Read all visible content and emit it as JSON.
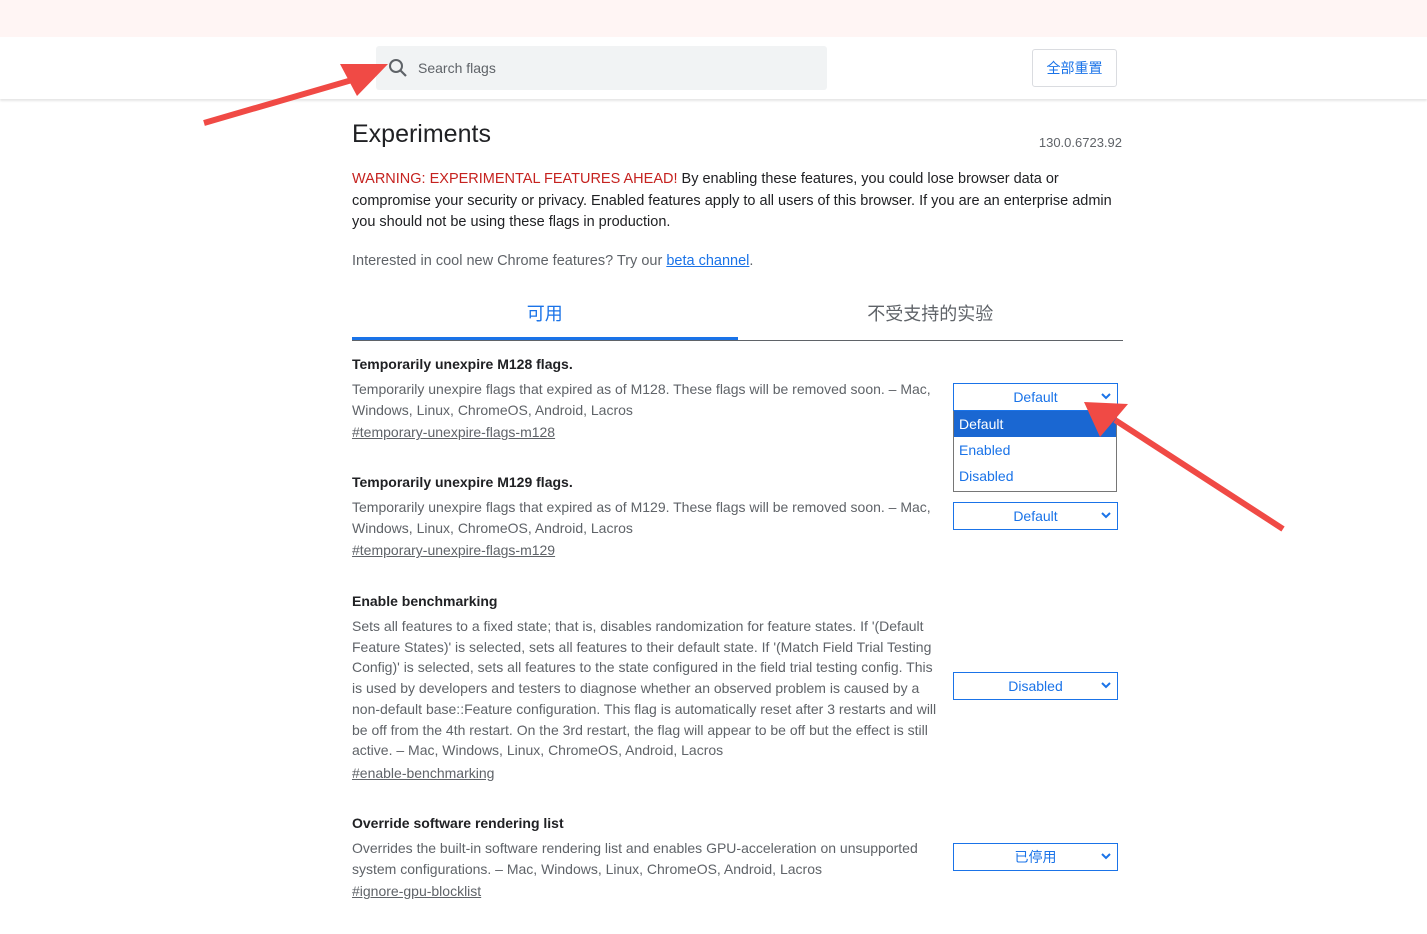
{
  "header": {
    "search_placeholder": "Search flags",
    "reset_all": "全部重置"
  },
  "page": {
    "title": "Experiments",
    "version": "130.0.6723.92",
    "warning_prefix": "WARNING: EXPERIMENTAL FEATURES AHEAD!",
    "warning_text": " By enabling these features, you could lose browser data or compromise your security or privacy. Enabled features apply to all users of this browser. If you are an enterprise admin you should not be using these flags in production.",
    "interest_text": "Interested in cool new Chrome features? Try our ",
    "beta_link": "beta channel",
    "interest_end": "."
  },
  "tabs": [
    {
      "label": "可用",
      "active": true
    },
    {
      "label": "不受支持的实验",
      "active": false
    }
  ],
  "flags": [
    {
      "name": "Temporarily unexpire M128 flags.",
      "description": "Temporarily unexpire flags that expired as of M128. These flags will be removed soon. – Mac, Windows, Linux, ChromeOS, Android, Lacros",
      "id": "#temporary-unexpire-flags-m128",
      "value": "Default"
    },
    {
      "name": "Temporarily unexpire M129 flags.",
      "description": "Temporarily unexpire flags that expired as of M129. These flags will be removed soon. – Mac, Windows, Linux, ChromeOS, Android, Lacros",
      "id": "#temporary-unexpire-flags-m129",
      "value": "Default"
    },
    {
      "name": "Enable benchmarking",
      "description": "Sets all features to a fixed state; that is, disables randomization for feature states. If '(Default Feature States)' is selected, sets all features to their default state. If '(Match Field Trial Testing Config)' is selected, sets all features to the state configured in the field trial testing config. This is used by developers and testers to diagnose whether an observed problem is caused by a non-default base::Feature configuration. This flag is automatically reset after 3 restarts and will be off from the 4th restart. On the 3rd restart, the flag will appear to be off but the effect is still active. – Mac, Windows, Linux, ChromeOS, Android, Lacros",
      "id": "#enable-benchmarking",
      "value": "Disabled"
    },
    {
      "name": "Override software rendering list",
      "description": "Overrides the built-in software rendering list and enables GPU-acceleration on unsupported system configurations. – Mac, Windows, Linux, ChromeOS, Android, Lacros",
      "id": "#ignore-gpu-blocklist",
      "value": "已停用"
    }
  ],
  "dropdown_options": [
    {
      "label": "Default",
      "selected": true
    },
    {
      "label": "Enabled",
      "selected": false
    },
    {
      "label": "Disabled",
      "selected": false
    }
  ],
  "colors": {
    "accent": "#1a73e8",
    "warning": "#c5221f",
    "annotation_arrow": "#f04a45"
  }
}
